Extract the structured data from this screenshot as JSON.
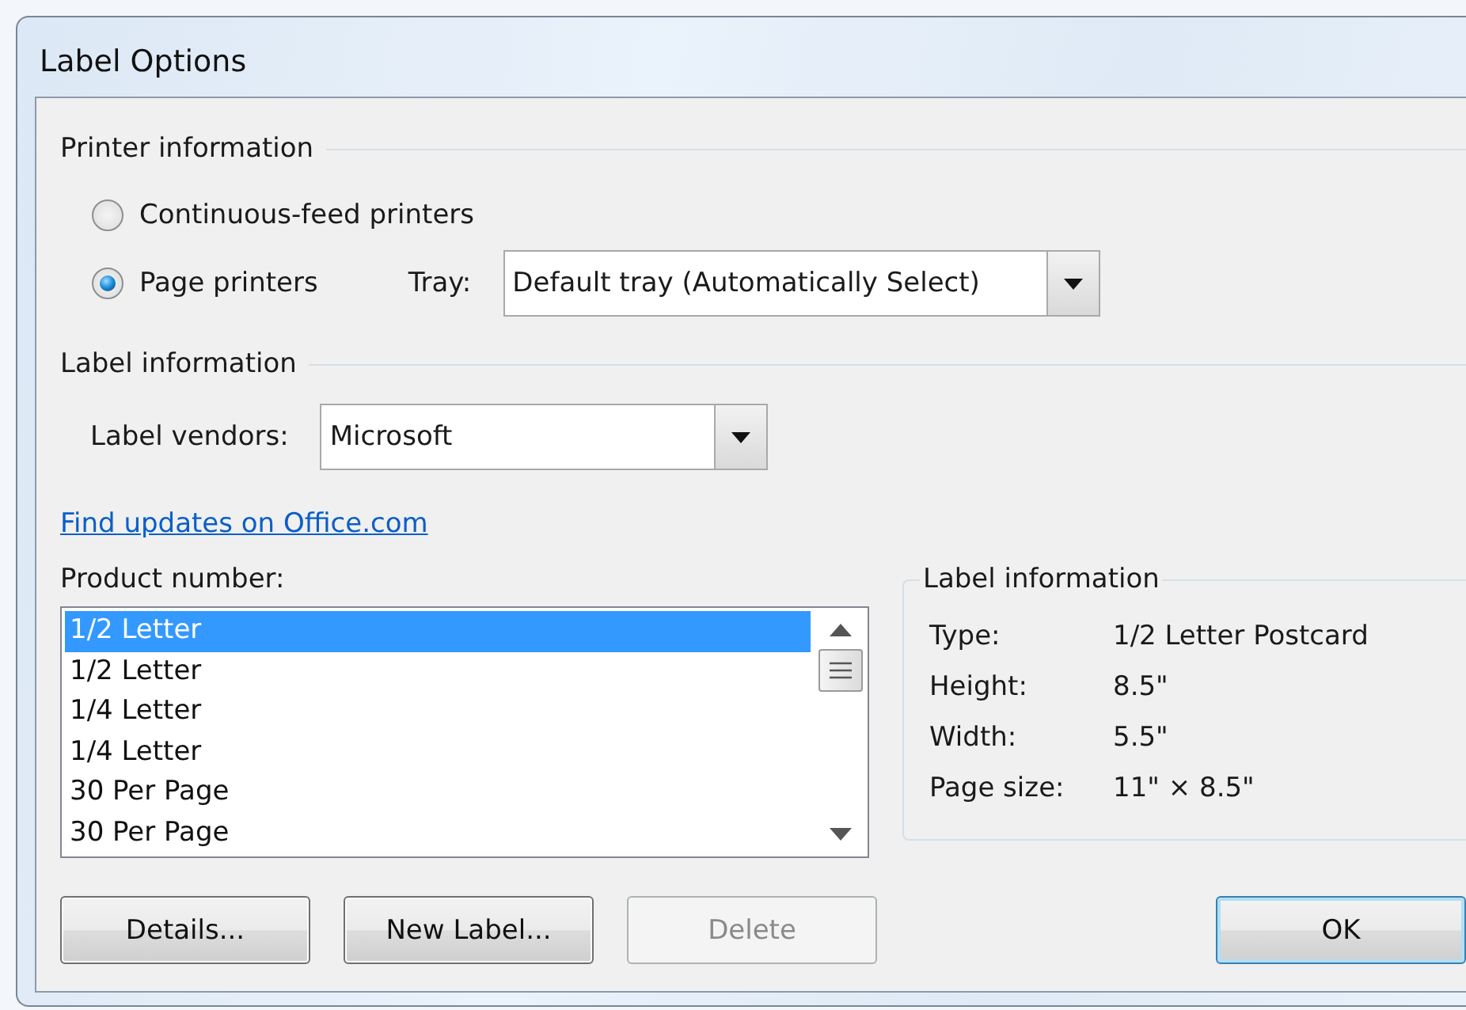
{
  "window": {
    "title": "Label Options"
  },
  "printer_information": {
    "heading": "Printer information",
    "options": [
      {
        "label": "Continuous-feed printers",
        "selected": false
      },
      {
        "label": "Page printers",
        "selected": true
      }
    ],
    "tray": {
      "label": "Tray:",
      "value": "Default tray (Automatically Select)"
    }
  },
  "label_information": {
    "heading": "Label information",
    "vendors": {
      "label": "Label vendors:",
      "value": "Microsoft"
    },
    "link": "Find updates on Office.com"
  },
  "product_number": {
    "label": "Product number:",
    "items": [
      {
        "label": "1/2 Letter",
        "selected": true
      },
      {
        "label": "1/2 Letter",
        "selected": false
      },
      {
        "label": "1/4 Letter",
        "selected": false
      },
      {
        "label": "1/4 Letter",
        "selected": false
      },
      {
        "label": "30 Per Page",
        "selected": false
      },
      {
        "label": "30 Per Page",
        "selected": false
      }
    ]
  },
  "label_details": {
    "heading": "Label information",
    "rows": [
      {
        "name": "Type:",
        "value": "1/2 Letter Postcard"
      },
      {
        "name": "Height:",
        "value": "8.5\""
      },
      {
        "name": "Width:",
        "value": "5.5\""
      },
      {
        "name": "Page size:",
        "value": "11\" × 8.5\""
      }
    ]
  },
  "buttons": [
    {
      "label": "Details...",
      "disabled": false,
      "default": false
    },
    {
      "label": "New Label...",
      "disabled": false,
      "default": false
    },
    {
      "label": "Delete",
      "disabled": true,
      "default": false
    },
    {
      "label": "OK",
      "disabled": false,
      "default": true
    }
  ]
}
